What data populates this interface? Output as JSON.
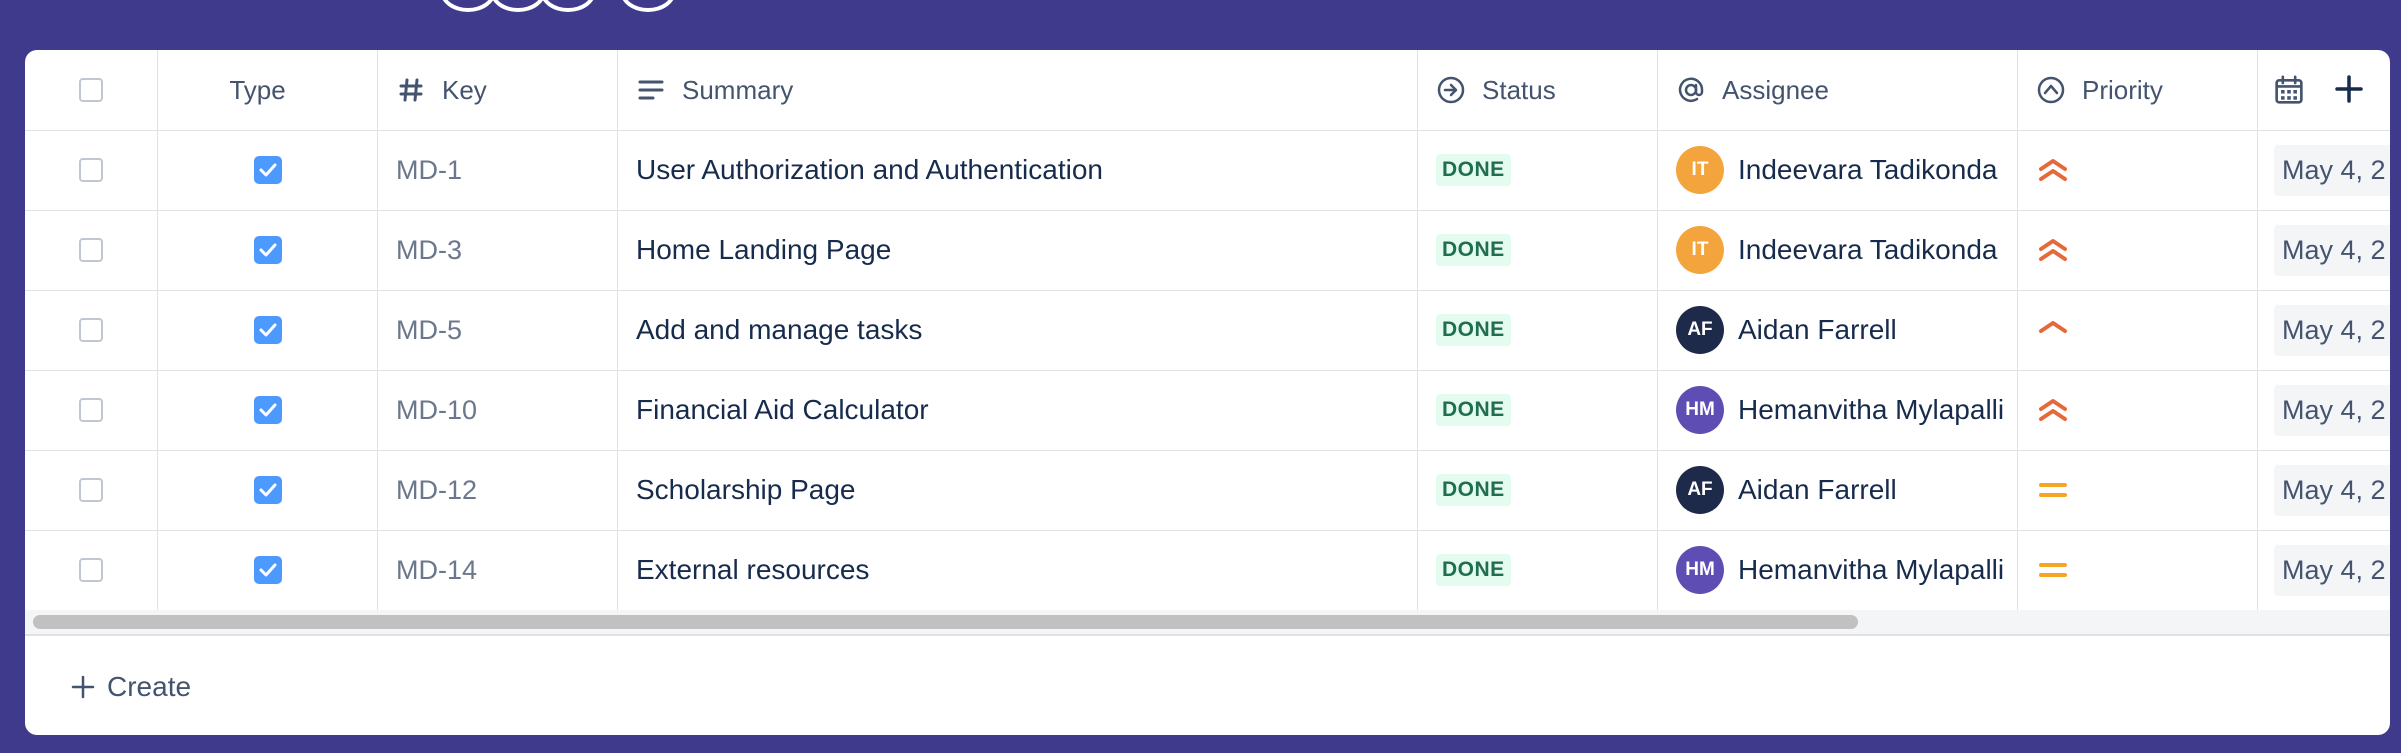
{
  "colors": {
    "background": "#403a8c",
    "done_bg": "#e3fcef",
    "done_text": "#216e4e",
    "priority_highest": "#e56a3b",
    "priority_medium": "#f5a623"
  },
  "header": {
    "type": "Type",
    "key": "Key",
    "summary": "Summary",
    "status": "Status",
    "assignee": "Assignee",
    "priority": "Priority"
  },
  "rows": [
    {
      "key": "MD-1",
      "summary": "User Authorization and Authentication",
      "status": "DONE",
      "assignee": {
        "initials": "IT",
        "name": "Indeevara Tadikonda",
        "color": "#f4a43c"
      },
      "priority": "highest",
      "date": "May 4, 2"
    },
    {
      "key": "MD-3",
      "summary": "Home Landing Page",
      "status": "DONE",
      "assignee": {
        "initials": "IT",
        "name": "Indeevara Tadikonda",
        "color": "#f4a43c"
      },
      "priority": "highest",
      "date": "May 4, 2"
    },
    {
      "key": "MD-5",
      "summary": "Add and manage tasks",
      "status": "DONE",
      "assignee": {
        "initials": "AF",
        "name": "Aidan Farrell",
        "color": "#1e2a4a"
      },
      "priority": "high",
      "date": "May 4, 2"
    },
    {
      "key": "MD-10",
      "summary": "Financial Aid Calculator",
      "status": "DONE",
      "assignee": {
        "initials": "HM",
        "name": "Hemanvitha Mylapalli",
        "color": "#5e4db2"
      },
      "priority": "highest",
      "date": "May 4, 2"
    },
    {
      "key": "MD-12",
      "summary": "Scholarship Page",
      "status": "DONE",
      "assignee": {
        "initials": "AF",
        "name": "Aidan Farrell",
        "color": "#1e2a4a"
      },
      "priority": "medium",
      "date": "May 4, 2"
    },
    {
      "key": "MD-14",
      "summary": "External resources",
      "status": "DONE",
      "assignee": {
        "initials": "HM",
        "name": "Hemanvitha Mylapalli",
        "color": "#5e4db2"
      },
      "priority": "medium",
      "date": "May 4, 2"
    }
  ],
  "footer": {
    "create_label": "Create"
  }
}
